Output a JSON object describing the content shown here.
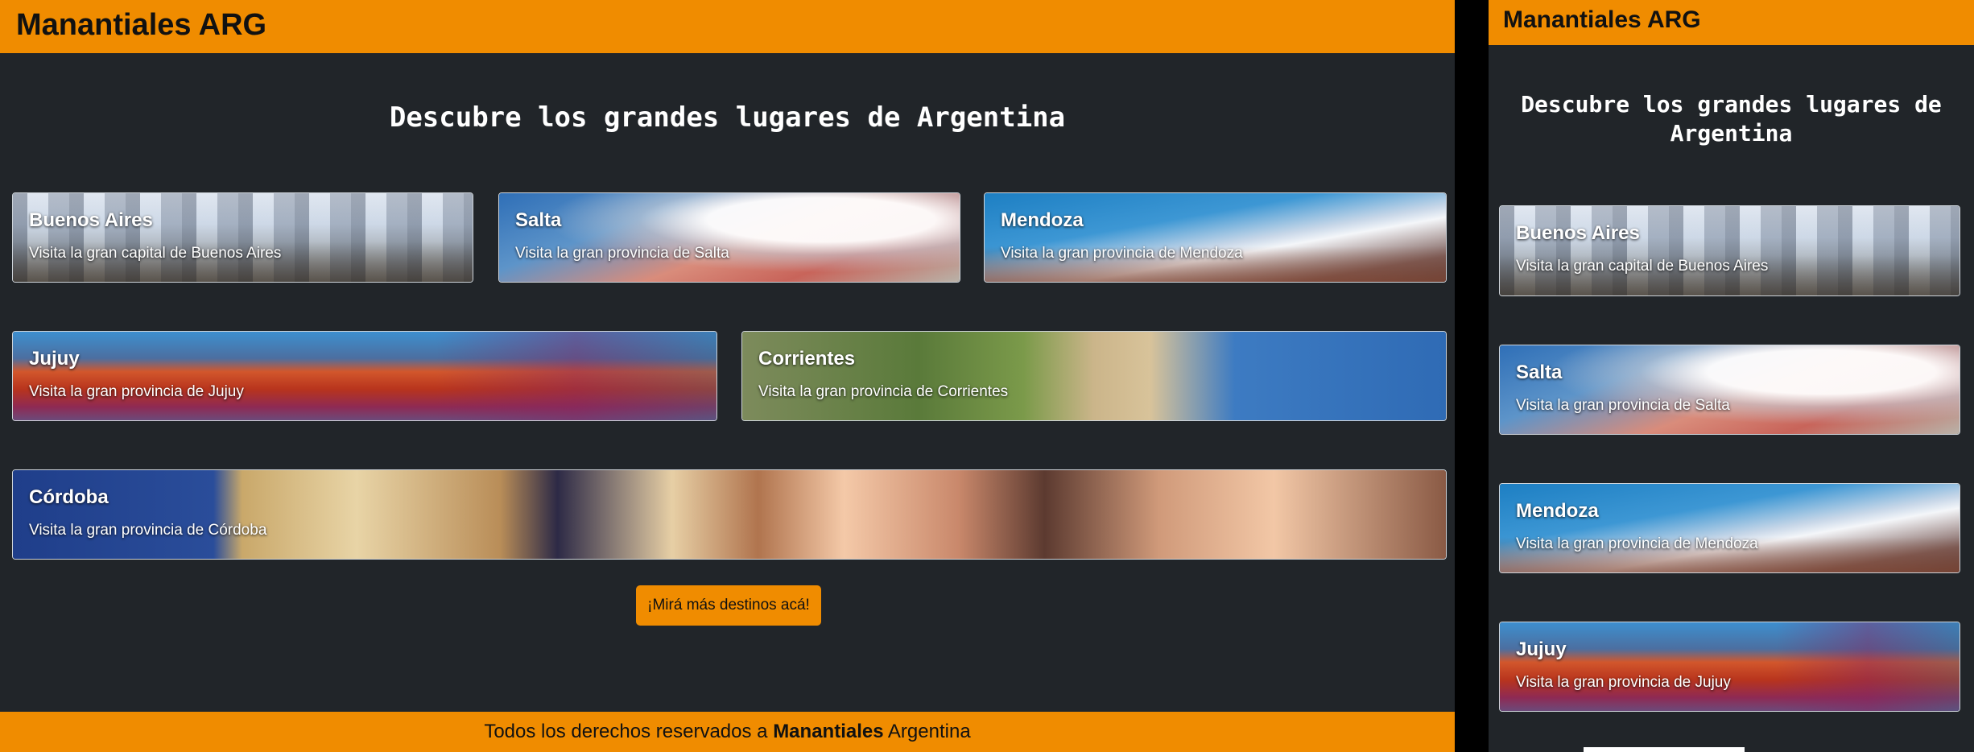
{
  "desktop": {
    "brand": "Manantiales ARG",
    "hero_title": "Descubre los grandes lugares de Argentina",
    "cards": [
      {
        "title": "Buenos Aires",
        "subtitle": "Visita la gran capital de Buenos Aires"
      },
      {
        "title": "Salta",
        "subtitle": "Visita la gran provincia de Salta"
      },
      {
        "title": "Mendoza",
        "subtitle": "Visita la gran provincia de Mendoza"
      },
      {
        "title": "Jujuy",
        "subtitle": "Visita la gran provincia de Jujuy"
      },
      {
        "title": "Corrientes",
        "subtitle": "Visita la gran provincia de Corrientes"
      },
      {
        "title": "Córdoba",
        "subtitle": "Visita la gran provincia de Córdoba"
      }
    ],
    "more_button": "¡Mirá más destinos acá!",
    "footer": {
      "prefix": "Todos los derechos reservados a ",
      "bold": "Manantiales",
      "suffix": " Argentina"
    }
  },
  "mobile": {
    "brand": "Manantiales ARG",
    "hero_title": "Descubre los grandes lugares de Argentina",
    "cards": [
      {
        "title": "Buenos Aires",
        "subtitle": "Visita la gran capital de Buenos Aires"
      },
      {
        "title": "Salta",
        "subtitle": "Visita la gran provincia de Salta"
      },
      {
        "title": "Mendoza",
        "subtitle": "Visita la gran provincia de Mendoza"
      },
      {
        "title": "Jujuy",
        "subtitle": "Visita la gran provincia de Jujuy"
      }
    ]
  },
  "colors": {
    "accent": "#f08c00",
    "background": "#212529",
    "text_light": "#ffffff",
    "text_dark": "#111111"
  }
}
